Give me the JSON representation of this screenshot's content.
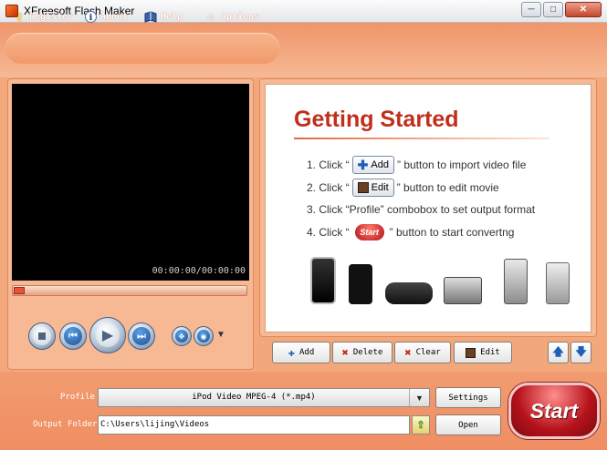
{
  "window": {
    "title": "XFreesoft Flash Maker",
    "minimize": "─",
    "maximize": "□",
    "close": "✕"
  },
  "menu": [
    {
      "label": "Register",
      "icon": "key-icon"
    },
    {
      "label": "About",
      "icon": "info-icon"
    },
    {
      "label": "Help",
      "icon": "book-icon"
    },
    {
      "label": "Options",
      "icon": "gear-icon"
    }
  ],
  "player": {
    "time": "00:00:00/00:00:00",
    "seek_fraction": 0.0
  },
  "getting_started": {
    "title": "Getting Started",
    "step1_pre": "1. Click “",
    "step1_btn": "Add",
    "step1_post": "” button to import video file",
    "step2_pre": "2. Click “",
    "step2_btn": "Edit",
    "step2_post": "” button to edit movie",
    "step3": "3. Click “Profile” combobox to set output format",
    "step4_pre": "4. Click “",
    "step4_btn": "Start",
    "step4_post": "” button to start convertng"
  },
  "actions": {
    "add": "Add",
    "delete": "Delete",
    "clear": "Clear",
    "edit": "Edit"
  },
  "bottom": {
    "profile_label": "Profile",
    "profile_value": "iPod Video MPEG-4 (*.mp4)",
    "settings": "Settings",
    "output_label": "Output Folder",
    "output_value": "C:\\Users\\lijing\\Videos",
    "open": "Open",
    "start": "Start"
  }
}
